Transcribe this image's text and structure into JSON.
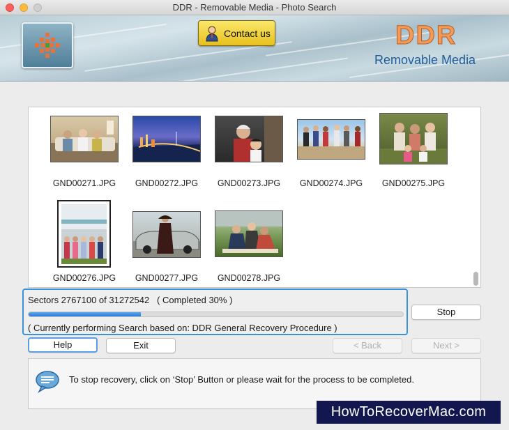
{
  "window": {
    "title": "DDR - Removable Media - Photo Search"
  },
  "banner": {
    "contact_label": "Contact us",
    "brand_title": "DDR",
    "brand_subtitle": "Removable Media"
  },
  "thumbnails": [
    {
      "name": "GND00271.JPG",
      "scene": "family-on-sofa"
    },
    {
      "name": "GND00272.JPG",
      "scene": "city-bridge-night"
    },
    {
      "name": "GND00273.JPG",
      "scene": "grandparent-child"
    },
    {
      "name": "GND00274.JPG",
      "scene": "friends-beach"
    },
    {
      "name": "GND00275.JPG",
      "scene": "family-outdoors"
    },
    {
      "name": "GND00276.JPG",
      "scene": "group-by-building"
    },
    {
      "name": "GND00277.JPG",
      "scene": "woman-by-car"
    },
    {
      "name": "GND00278.JPG",
      "scene": "students-on-grass"
    }
  ],
  "progress": {
    "sectors_text": "Sectors 2767100 of 31272542   ( Completed 30% )",
    "completed_fraction": 0.3,
    "status_text": "( Currently performing Search based on: DDR General Recovery Procedure )"
  },
  "buttons": {
    "stop": "Stop",
    "help": "Help",
    "exit": "Exit",
    "back": "< Back",
    "next": "Next >"
  },
  "info": {
    "message": "To stop recovery, click on ‘Stop’ Button or please wait for the process to be completed."
  },
  "watermark": "HowToRecoverMac.com",
  "colors": {
    "accent_blue": "#3c92d8",
    "brand_orange": "#f39a57",
    "brand_blue": "#1f5d9a",
    "contact_yellow": "#f0d23a"
  }
}
